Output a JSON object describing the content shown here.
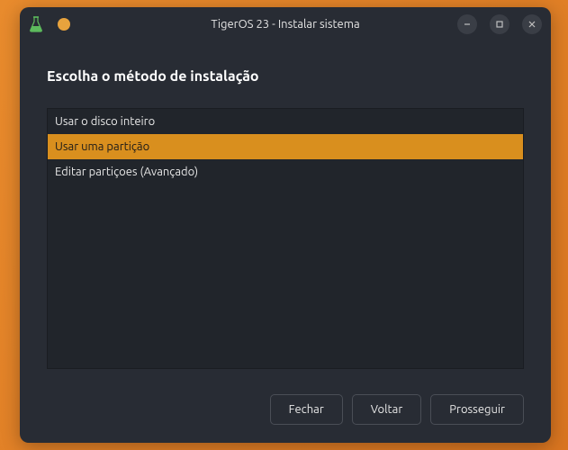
{
  "window": {
    "title": "TigerOS 23 - Instalar sistema"
  },
  "page": {
    "heading": "Escolha o método de instalação"
  },
  "options": {
    "items": [
      {
        "label": "Usar o disco inteiro",
        "selected": false
      },
      {
        "label": "Usar uma partição",
        "selected": true
      },
      {
        "label": "Editar partiçoes (Avançado)",
        "selected": false
      }
    ]
  },
  "buttons": {
    "close": "Fechar",
    "back": "Voltar",
    "next": "Prosseguir"
  }
}
